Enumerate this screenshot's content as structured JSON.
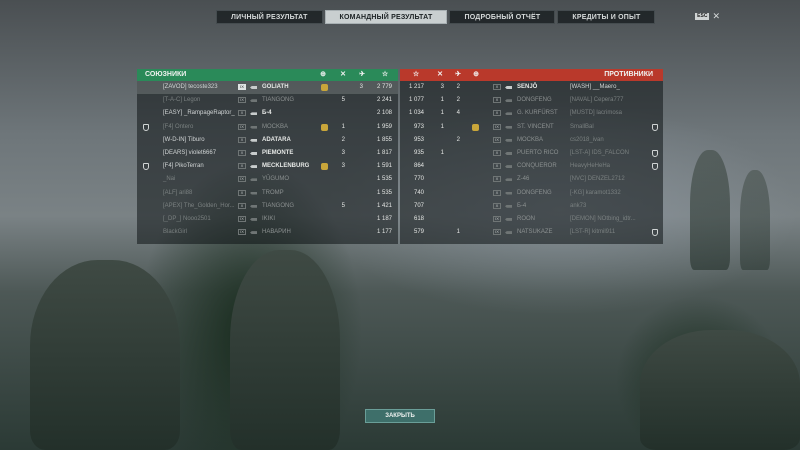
{
  "tabs": [
    {
      "label": "ЛИЧНЫЙ РЕЗУЛЬТАТ",
      "active": false
    },
    {
      "label": "КОМАНДНЫЙ РЕЗУЛЬТАТ",
      "active": true
    },
    {
      "label": "ПОДРОБНЫЙ ОТЧЁТ",
      "active": false
    },
    {
      "label": "КРЕДИТЫ И ОПЫТ",
      "active": false
    }
  ],
  "esc_label": "ESC",
  "allies": {
    "title": "СОЮЗНИКИ",
    "players": [
      {
        "player": "[ZAVOD] tecoste323",
        "tier": "IX",
        "ship": "GOLIATH",
        "medal": true,
        "ships": "",
        "planes": "3",
        "exp": "2 779",
        "alive": true,
        "self": true
      },
      {
        "player": "[T-A-C] Legon",
        "tier": "IX",
        "ship": "TIANGONG",
        "medal": false,
        "ships": "5",
        "planes": "",
        "exp": "2 241",
        "alive": false
      },
      {
        "player": "[EASY] _RampageRaptor_",
        "tier": "X",
        "ship": "Б-4",
        "medal": false,
        "ships": "",
        "planes": "",
        "exp": "2 108",
        "alive": true
      },
      {
        "player": "[F4] Ontero",
        "tier": "IX",
        "ship": "MOCKBA",
        "medal": true,
        "ships": "1",
        "planes": "",
        "exp": "1 959",
        "alive": false,
        "division": true
      },
      {
        "player": "[W-D-IN] Tiburo",
        "tier": "X",
        "ship": "ADATARA",
        "medal": false,
        "ships": "2",
        "planes": "",
        "exp": "1 855",
        "alive": true
      },
      {
        "player": "[DEARS] violet6667",
        "tier": "X",
        "ship": "PIEMONTE",
        "medal": false,
        "ships": "3",
        "planes": "",
        "exp": "1 817",
        "alive": true
      },
      {
        "player": "[F4] PikoTerran",
        "tier": "X",
        "ship": "MECKLENBURG",
        "medal": true,
        "ships": "3",
        "planes": "",
        "exp": "1 591",
        "alive": true,
        "division": true
      },
      {
        "player": "_Nai",
        "tier": "IX",
        "ship": "YŪGUMO",
        "medal": false,
        "ships": "",
        "planes": "",
        "exp": "1 535",
        "alive": false
      },
      {
        "player": "[ALF] ari88",
        "tier": "X",
        "ship": "TROMP",
        "medal": false,
        "ships": "",
        "planes": "",
        "exp": "1 535",
        "alive": false
      },
      {
        "player": "[APEX] The_Golden_Hor...",
        "tier": "X",
        "ship": "TIANGONG",
        "medal": false,
        "ships": "5",
        "planes": "",
        "exp": "1 421",
        "alive": false
      },
      {
        "player": "[_DP_] Nooo2501",
        "tier": "IX",
        "ship": "IKIKI",
        "medal": false,
        "ships": "",
        "planes": "",
        "exp": "1 187",
        "alive": false
      },
      {
        "player": "BlackGirl",
        "tier": "IX",
        "ship": "НАВАРИН",
        "medal": false,
        "ships": "",
        "planes": "",
        "exp": "1 177",
        "alive": false
      }
    ]
  },
  "enemies": {
    "title": "ПРОТИВНИКИ",
    "players": [
      {
        "exp": "1 217",
        "ships": "3",
        "planes": "2",
        "medal": false,
        "tier": "X",
        "ship": "SENJŌ",
        "player": "[WASH] __Maero_",
        "alive": true
      },
      {
        "exp": "1 077",
        "ships": "1",
        "planes": "2",
        "medal": false,
        "tier": "X",
        "ship": "DONGFENG",
        "player": "[NAVAL] Cepera777",
        "alive": false
      },
      {
        "exp": "1 034",
        "ships": "1",
        "planes": "4",
        "medal": false,
        "tier": "X",
        "ship": "G. KURFÜRST",
        "player": "[MUSTD] lacrimosa",
        "alive": false
      },
      {
        "exp": "973",
        "ships": "1",
        "planes": "",
        "medal": true,
        "tier": "IX",
        "ship": "ST. VINCENT",
        "player": "SmallBal",
        "alive": false
      },
      {
        "exp": "953",
        "ships": "",
        "planes": "2",
        "medal": false,
        "tier": "IX",
        "ship": "MOCKBA",
        "player": "cs2018_ivan",
        "alive": false
      },
      {
        "exp": "935",
        "ships": "1",
        "planes": "",
        "medal": false,
        "tier": "X",
        "ship": "PUERTO RICO",
        "player": "[LST-A] IDS_FALCON",
        "alive": false
      },
      {
        "exp": "864",
        "ships": "",
        "planes": "",
        "medal": false,
        "tier": "X",
        "ship": "CONQUEROR",
        "player": "HeavyHeHeHa",
        "alive": false
      },
      {
        "exp": "770",
        "ships": "",
        "planes": "",
        "medal": false,
        "tier": "X",
        "ship": "Z-46",
        "player": "[NVC] DENZEL2712",
        "alive": false
      },
      {
        "exp": "740",
        "ships": "",
        "planes": "",
        "medal": false,
        "tier": "X",
        "ship": "DONGFENG",
        "player": "[-KG] karamot1332",
        "alive": false
      },
      {
        "exp": "707",
        "ships": "",
        "planes": "",
        "medal": false,
        "tier": "X",
        "ship": "Б-4",
        "player": "ank73",
        "alive": false
      },
      {
        "exp": "618",
        "ships": "",
        "planes": "",
        "medal": false,
        "tier": "IX",
        "ship": "ROON",
        "player": "[DEMON] NOtbing_idtr...",
        "alive": false
      },
      {
        "exp": "579",
        "ships": "",
        "planes": "1",
        "medal": false,
        "tier": "IX",
        "ship": "NATSUKAZE",
        "player": "[LST-R] kitmil911",
        "alive": false
      }
    ]
  },
  "close_label": "ЗАКРЫТЬ",
  "colors": {
    "ally": "#2a8a59",
    "enemy": "#b9392b",
    "medal": "#c9a63a"
  }
}
